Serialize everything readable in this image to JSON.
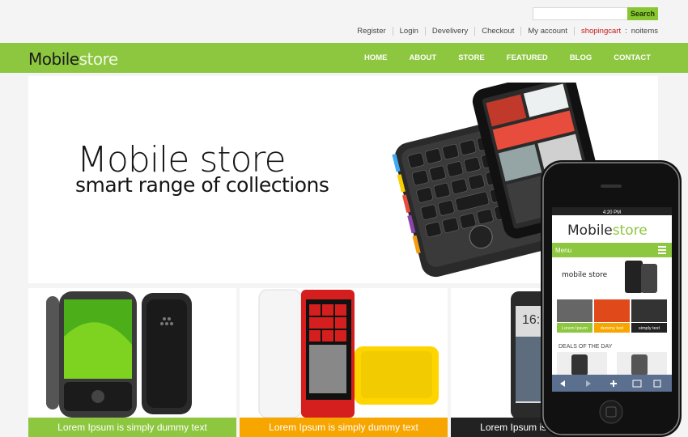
{
  "search": {
    "placeholder": "",
    "button_label": "Search"
  },
  "toplinks": {
    "register": "Register",
    "login": "Login",
    "delivery": "Develivery",
    "checkout": "Checkout",
    "account": "My account",
    "cart": "shopingcart",
    "sep": ":",
    "items": "noitems"
  },
  "logo": {
    "part1": "Mobile",
    "part2": "store"
  },
  "nav": {
    "home": "HOME",
    "about": "ABOUT",
    "store": "STORE",
    "featured": "FEATURED",
    "blog": "BLOG",
    "contact": "CONTACT"
  },
  "hero": {
    "title": "Mobile store",
    "subtitle": "smart range of collections"
  },
  "products": [
    {
      "caption": "Lorem Ipsum is simply dummy text",
      "color": "#8dc63f"
    },
    {
      "caption": "Lorem Ipsum is simply dummy text",
      "color": "#f7a600"
    },
    {
      "caption": "Lorem Ipsum is simply dummy text",
      "color": "#222222"
    }
  ],
  "phone_mock": {
    "time": "4:20 PM",
    "logo1": "Mobile",
    "logo2": "store",
    "menu": "Menu",
    "banner_title": "mobile store",
    "tab1": "Lorem Ipsum",
    "tab2": "dummy text",
    "tab3": "simply text",
    "deals": "DEALS OF THE DAY"
  },
  "colors": {
    "brand_green": "#8dc63f",
    "orange": "#f7a600",
    "cart_red": "#c31a1a"
  }
}
